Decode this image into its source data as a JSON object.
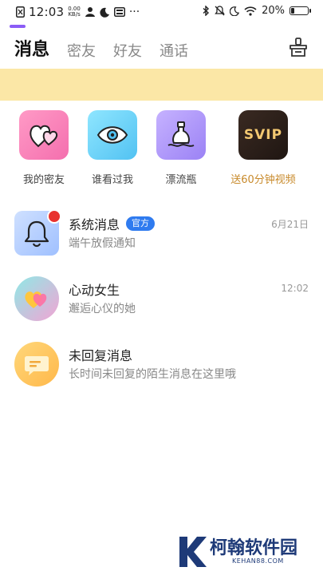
{
  "status_bar": {
    "time": "12:03",
    "net_speed_value": "0.00",
    "net_speed_unit": "KB/s",
    "battery": "20%"
  },
  "tabs": [
    {
      "label": "消息",
      "active": true
    },
    {
      "label": "密友",
      "active": false
    },
    {
      "label": "好友",
      "active": false
    },
    {
      "label": "通话",
      "active": false
    }
  ],
  "features": [
    {
      "label": "我的密友",
      "icon": "heart-icon"
    },
    {
      "label": "谁看过我",
      "icon": "eye-icon"
    },
    {
      "label": "漂流瓶",
      "icon": "bottle-icon"
    },
    {
      "label": "送60分钟视频",
      "icon": "svip-icon",
      "tile_text": "SVIP"
    }
  ],
  "messages": [
    {
      "title": "系统消息",
      "badge": "官方",
      "subtitle": "端午放假通知",
      "time": "6月21日",
      "icon": "bell-icon",
      "unread": true
    },
    {
      "title": "心动女生",
      "subtitle": "邂逅心仪的她",
      "time": "12:02",
      "icon": "hearts-icon"
    },
    {
      "title": "未回复消息",
      "subtitle": "长时间未回复的陌生消息在这里哦",
      "icon": "chat-icon"
    }
  ],
  "watermark": {
    "text": "柯翰软件园",
    "url": "KEHAN88.COM"
  },
  "colors": {
    "accent": "#8b5cf6",
    "banner": "#fbe7a6",
    "badge": "#2f7bef",
    "unread_dot": "#e8322e",
    "svip_label": "#c88a2b"
  }
}
